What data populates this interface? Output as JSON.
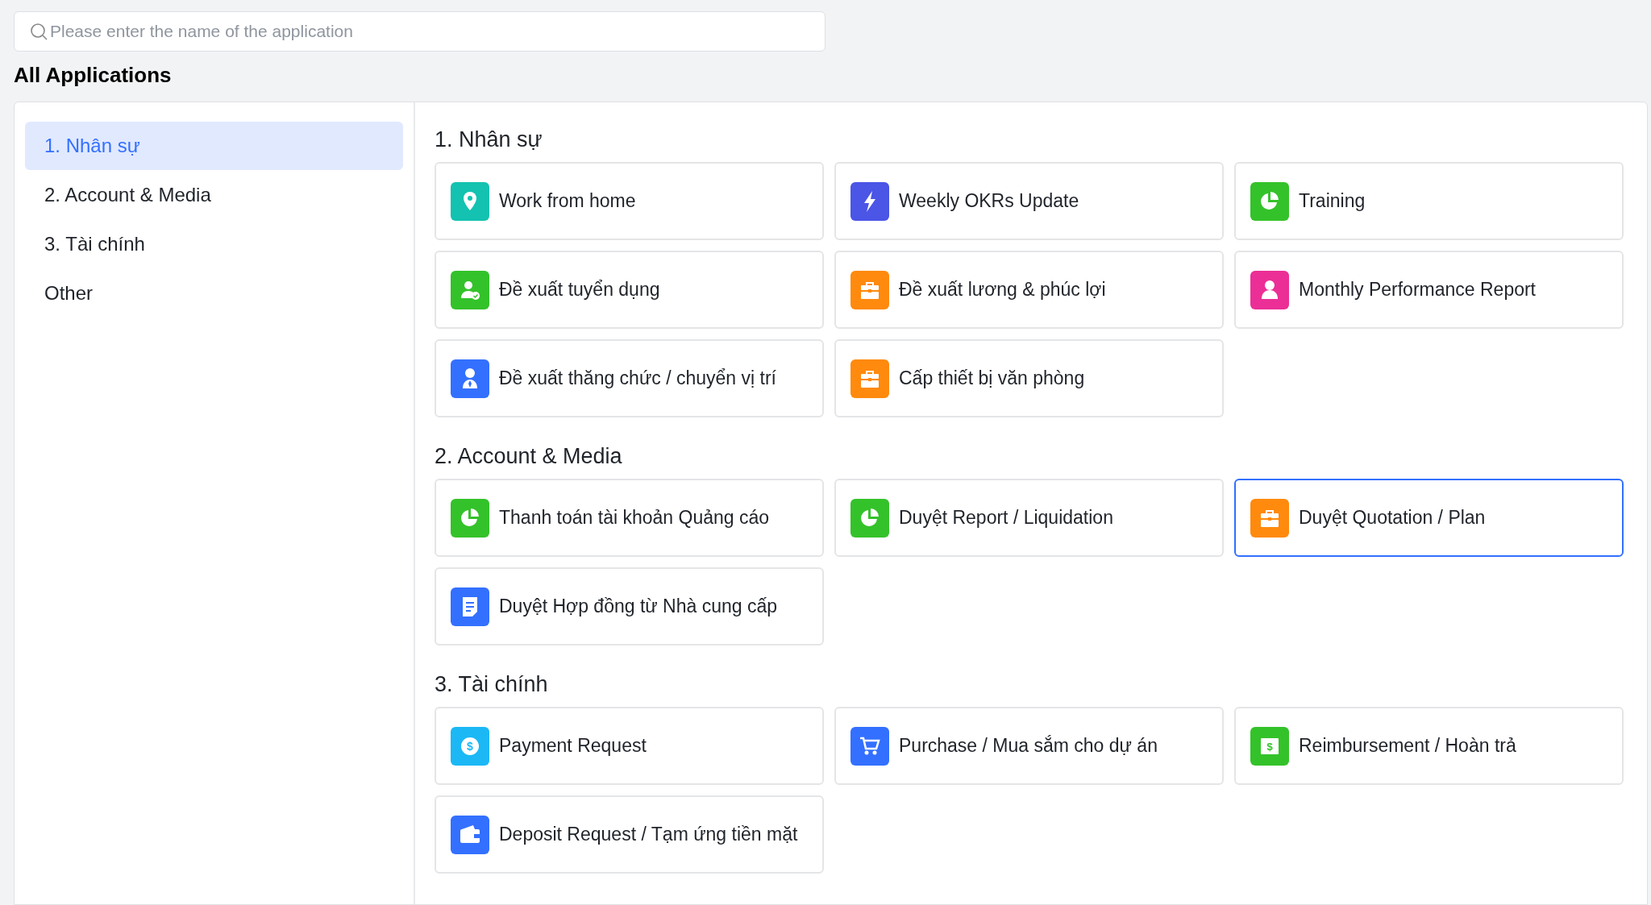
{
  "search": {
    "placeholder": "Please enter the name of the application"
  },
  "title": "All Applications",
  "sidebar": {
    "items": [
      {
        "label": "1. Nhân sự",
        "selected": true
      },
      {
        "label": "2. Account & Media",
        "selected": false
      },
      {
        "label": "3. Tài chính",
        "selected": false
      },
      {
        "label": "Other",
        "selected": false
      }
    ]
  },
  "sections": [
    {
      "title": "1. Nhân sự",
      "apps": [
        {
          "label": "Work from home",
          "kind": "pin",
          "color": "#13c2b0",
          "selected": false
        },
        {
          "label": "Weekly OKRs Update",
          "kind": "bolt",
          "color": "#4b55e6",
          "selected": false
        },
        {
          "label": "Training",
          "kind": "pie",
          "color": "#34c22a",
          "selected": false
        },
        {
          "label": "Đề xuất tuyển dụng",
          "kind": "user-check",
          "color": "#34c22a",
          "selected": false
        },
        {
          "label": "Đề xuất lương & phúc lợi",
          "kind": "briefcase",
          "color": "#ff8a0d",
          "selected": false
        },
        {
          "label": "Monthly Performance Report",
          "kind": "user",
          "color": "#eb2f96",
          "selected": false
        },
        {
          "label": "Đề xuất thăng chức / chuyển vị trí",
          "kind": "user-tie",
          "color": "#3370ff",
          "selected": false
        },
        {
          "label": "Cấp thiết bị văn phòng",
          "kind": "box",
          "color": "#ff8a0d",
          "selected": false
        }
      ]
    },
    {
      "title": "2. Account & Media",
      "apps": [
        {
          "label": "Thanh toán tài khoản Quảng cáo",
          "kind": "pie",
          "color": "#34c22a",
          "selected": false
        },
        {
          "label": "Duyệt Report / Liquidation",
          "kind": "pie",
          "color": "#34c22a",
          "selected": false
        },
        {
          "label": "Duyệt Quotation / Plan",
          "kind": "briefcase",
          "color": "#ff8a0d",
          "selected": true
        },
        {
          "label": "Duyệt Hợp đồng từ Nhà cung cấp",
          "kind": "document",
          "color": "#3370ff",
          "selected": false
        }
      ]
    },
    {
      "title": "3. Tài chính",
      "apps": [
        {
          "label": "Payment Request",
          "kind": "dollar",
          "symbol": "$",
          "color": "#1bb8f5",
          "selected": false
        },
        {
          "label": "Purchase / Mua sắm cho dự án",
          "kind": "cart",
          "color": "#3370ff",
          "selected": false
        },
        {
          "label": "Reimbursement / Hoàn trả",
          "kind": "banknote",
          "symbol": "$",
          "color": "#34c22a",
          "selected": false
        },
        {
          "label": "Deposit Request / Tạm ứng tiền mặt",
          "kind": "wallet",
          "color": "#3370ff",
          "selected": false
        }
      ]
    }
  ]
}
